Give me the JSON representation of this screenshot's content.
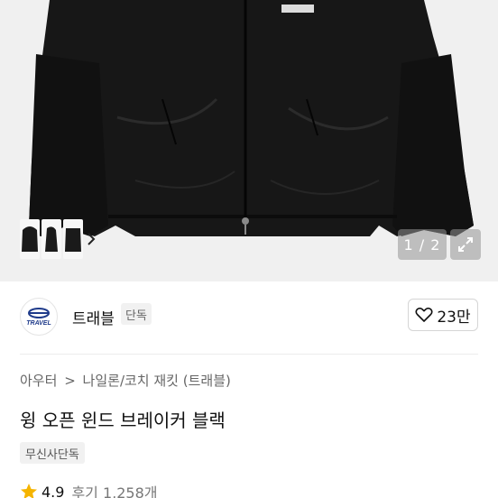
{
  "gallery": {
    "counter": "1 / 2",
    "thumbnails": [
      "jacket-front",
      "jacket-side",
      "jacket-back"
    ]
  },
  "brand": {
    "logo_text": "TRAVEL",
    "name": "트래블",
    "badge": "단독",
    "likes": "23만"
  },
  "product": {
    "breadcrumb": [
      "아우터",
      "나일론/코치 재킷 (트래블)"
    ],
    "breadcrumb_separator": ">",
    "title": "윙 오픈 윈드 브레이커 블랙",
    "tag": "무신사단독"
  },
  "rating": {
    "score": "4.9",
    "reviews": "후기 1,258개"
  },
  "colors": {
    "star": "#f5b400",
    "jacket": "#161616",
    "background": "#f0f0f0"
  }
}
